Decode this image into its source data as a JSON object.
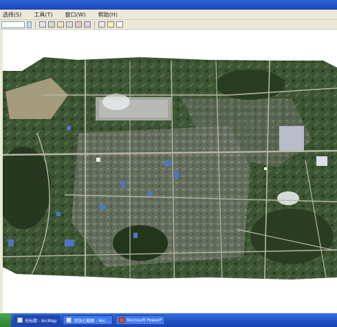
{
  "colors": {
    "title_blue": "#2d63d8",
    "menu_bg": "#ece9d8",
    "taskbar_blue": "#2a5bd7",
    "vegetation": "#2f4a27",
    "urban": "#6f7a68",
    "road": "#b8b9a9",
    "roof_blue": "#4f76c4"
  },
  "menubar": {
    "items": [
      {
        "label": "选择(S)"
      },
      {
        "label": "工具(T)"
      },
      {
        "label": "窗口(W)"
      },
      {
        "label": "帮助(H)"
      }
    ]
  },
  "toolbar": {
    "scale_value": "",
    "icons": [
      "zoom-in-icon",
      "zoom-out-icon",
      "pan-icon",
      "full-extent-icon",
      "identify-icon",
      "find-icon",
      "measure-icon",
      "hyperlink-icon",
      "help-icon"
    ]
  },
  "map": {
    "content": "satellite-imagery"
  },
  "taskbar": {
    "items": [
      {
        "label": "无标题 - ArcMap",
        "icon": "arcmap-icon"
      },
      {
        "label": "添加七截图 - Mic...",
        "icon": "window-icon"
      },
      {
        "label": "Microsoft PowerP",
        "icon": "powerpoint-icon"
      }
    ]
  }
}
